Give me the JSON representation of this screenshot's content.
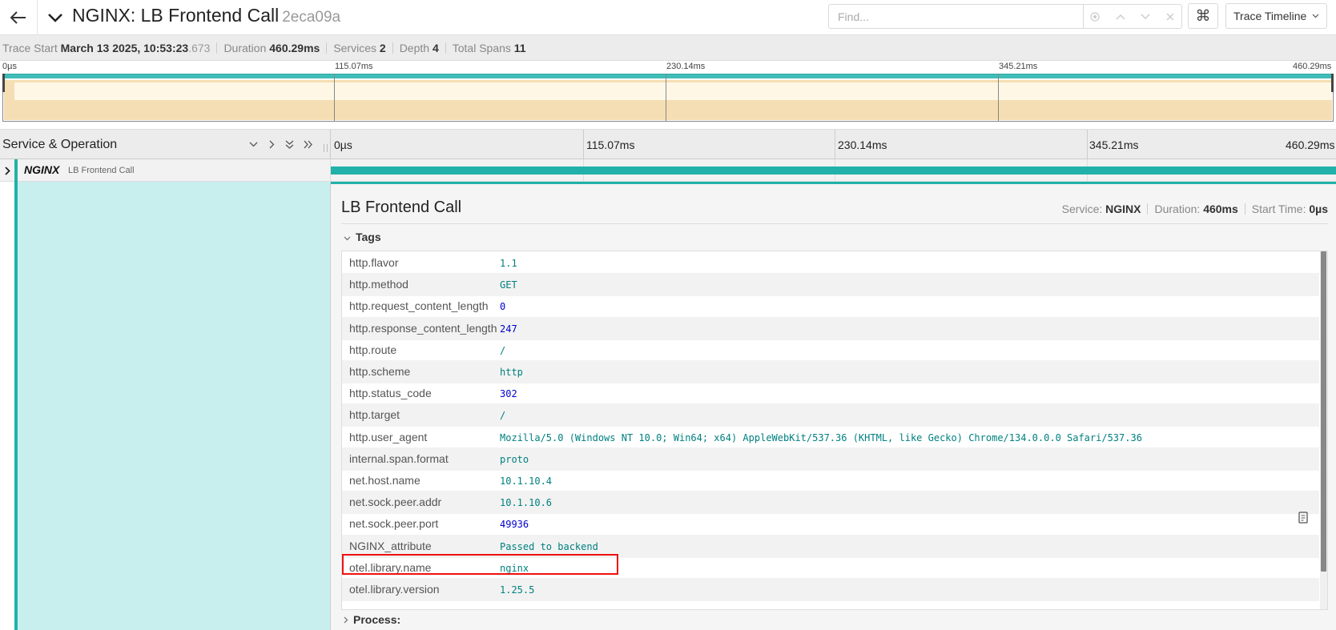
{
  "header": {
    "service_name": "NGINX",
    "operation": "LB Frontend Call",
    "title": "NGINX: LB Frontend Call",
    "trace_id": "2eca09a",
    "find_placeholder": "Find...",
    "kbd_glyph": "⌘",
    "view_select": "Trace Timeline"
  },
  "summary": {
    "trace_start_label": "Trace Start",
    "trace_start_value": "March 13 2025, 10:53:23",
    "trace_start_ms": ".673",
    "duration_label": "Duration",
    "duration_value": "460.29ms",
    "services_label": "Services",
    "services_value": "2",
    "depth_label": "Depth",
    "depth_value": "4",
    "total_spans_label": "Total Spans",
    "total_spans_value": "11"
  },
  "minimap": {
    "ticks": [
      "0µs",
      "115.07ms",
      "230.14ms",
      "345.21ms",
      "460.29ms"
    ]
  },
  "timeline": {
    "column_label": "Service & Operation",
    "ticks": [
      "0µs",
      "115.07ms",
      "230.14ms",
      "345.21ms",
      "460.29ms"
    ]
  },
  "span": {
    "service": "NGINX",
    "operation": "LB Frontend Call"
  },
  "detail": {
    "title": "LB Frontend Call",
    "service_label": "Service:",
    "service_value": "NGINX",
    "duration_label": "Duration:",
    "duration_value": "460ms",
    "start_label": "Start Time:",
    "start_value": "0µs",
    "tags_label": "Tags",
    "process_label": "Process:",
    "tags": [
      {
        "key": "http.flavor",
        "value": "1.1",
        "type": "str"
      },
      {
        "key": "http.method",
        "value": "GET",
        "type": "str"
      },
      {
        "key": "http.request_content_length",
        "value": "0",
        "type": "num"
      },
      {
        "key": "http.response_content_length",
        "value": "247",
        "type": "num"
      },
      {
        "key": "http.route",
        "value": "/",
        "type": "str"
      },
      {
        "key": "http.scheme",
        "value": "http",
        "type": "str"
      },
      {
        "key": "http.status_code",
        "value": "302",
        "type": "num"
      },
      {
        "key": "http.target",
        "value": "/",
        "type": "str"
      },
      {
        "key": "http.user_agent",
        "value": "Mozilla/5.0 (Windows NT 10.0; Win64; x64) AppleWebKit/537.36 (KHTML, like Gecko) Chrome/134.0.0.0 Safari/537.36",
        "type": "str"
      },
      {
        "key": "internal.span.format",
        "value": "proto",
        "type": "str"
      },
      {
        "key": "net.host.name",
        "value": "10.1.10.4",
        "type": "str"
      },
      {
        "key": "net.sock.peer.addr",
        "value": "10.1.10.6",
        "type": "str"
      },
      {
        "key": "net.sock.peer.port",
        "value": "49936",
        "type": "num"
      },
      {
        "key": "NGINX_attribute",
        "value": "Passed to backend",
        "type": "str"
      },
      {
        "key": "otel.library.name",
        "value": "nginx",
        "type": "str"
      },
      {
        "key": "otel.library.version",
        "value": "1.25.5",
        "type": "str"
      }
    ]
  },
  "colors": {
    "accent": "#20b2aa",
    "span_bg": "#c9eeee",
    "minimap_fill": "#f5deb3",
    "highlight": "#ee1111"
  }
}
